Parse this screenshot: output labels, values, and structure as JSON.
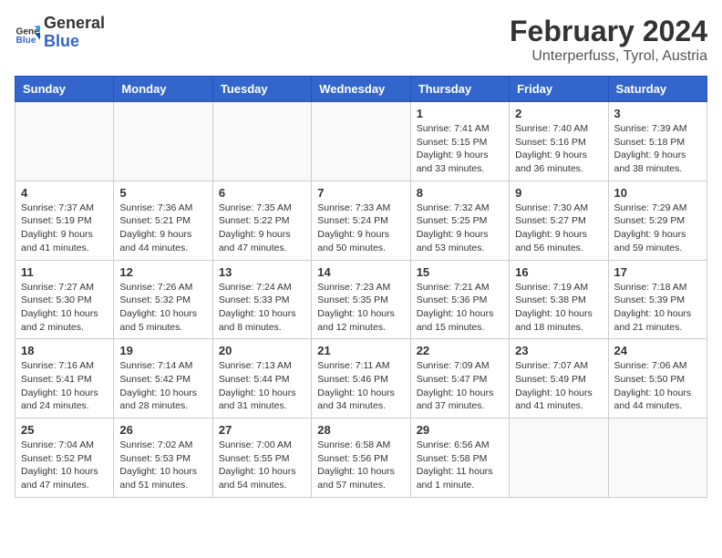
{
  "header": {
    "logo_line1": "General",
    "logo_line2": "Blue",
    "main_title": "February 2024",
    "sub_title": "Unterperfuss, Tyrol, Austria"
  },
  "days_of_week": [
    "Sunday",
    "Monday",
    "Tuesday",
    "Wednesday",
    "Thursday",
    "Friday",
    "Saturday"
  ],
  "weeks": [
    [
      {
        "day": "",
        "info": ""
      },
      {
        "day": "",
        "info": ""
      },
      {
        "day": "",
        "info": ""
      },
      {
        "day": "",
        "info": ""
      },
      {
        "day": "1",
        "info": "Sunrise: 7:41 AM\nSunset: 5:15 PM\nDaylight: 9 hours\nand 33 minutes."
      },
      {
        "day": "2",
        "info": "Sunrise: 7:40 AM\nSunset: 5:16 PM\nDaylight: 9 hours\nand 36 minutes."
      },
      {
        "day": "3",
        "info": "Sunrise: 7:39 AM\nSunset: 5:18 PM\nDaylight: 9 hours\nand 38 minutes."
      }
    ],
    [
      {
        "day": "4",
        "info": "Sunrise: 7:37 AM\nSunset: 5:19 PM\nDaylight: 9 hours\nand 41 minutes."
      },
      {
        "day": "5",
        "info": "Sunrise: 7:36 AM\nSunset: 5:21 PM\nDaylight: 9 hours\nand 44 minutes."
      },
      {
        "day": "6",
        "info": "Sunrise: 7:35 AM\nSunset: 5:22 PM\nDaylight: 9 hours\nand 47 minutes."
      },
      {
        "day": "7",
        "info": "Sunrise: 7:33 AM\nSunset: 5:24 PM\nDaylight: 9 hours\nand 50 minutes."
      },
      {
        "day": "8",
        "info": "Sunrise: 7:32 AM\nSunset: 5:25 PM\nDaylight: 9 hours\nand 53 minutes."
      },
      {
        "day": "9",
        "info": "Sunrise: 7:30 AM\nSunset: 5:27 PM\nDaylight: 9 hours\nand 56 minutes."
      },
      {
        "day": "10",
        "info": "Sunrise: 7:29 AM\nSunset: 5:29 PM\nDaylight: 9 hours\nand 59 minutes."
      }
    ],
    [
      {
        "day": "11",
        "info": "Sunrise: 7:27 AM\nSunset: 5:30 PM\nDaylight: 10 hours\nand 2 minutes."
      },
      {
        "day": "12",
        "info": "Sunrise: 7:26 AM\nSunset: 5:32 PM\nDaylight: 10 hours\nand 5 minutes."
      },
      {
        "day": "13",
        "info": "Sunrise: 7:24 AM\nSunset: 5:33 PM\nDaylight: 10 hours\nand 8 minutes."
      },
      {
        "day": "14",
        "info": "Sunrise: 7:23 AM\nSunset: 5:35 PM\nDaylight: 10 hours\nand 12 minutes."
      },
      {
        "day": "15",
        "info": "Sunrise: 7:21 AM\nSunset: 5:36 PM\nDaylight: 10 hours\nand 15 minutes."
      },
      {
        "day": "16",
        "info": "Sunrise: 7:19 AM\nSunset: 5:38 PM\nDaylight: 10 hours\nand 18 minutes."
      },
      {
        "day": "17",
        "info": "Sunrise: 7:18 AM\nSunset: 5:39 PM\nDaylight: 10 hours\nand 21 minutes."
      }
    ],
    [
      {
        "day": "18",
        "info": "Sunrise: 7:16 AM\nSunset: 5:41 PM\nDaylight: 10 hours\nand 24 minutes."
      },
      {
        "day": "19",
        "info": "Sunrise: 7:14 AM\nSunset: 5:42 PM\nDaylight: 10 hours\nand 28 minutes."
      },
      {
        "day": "20",
        "info": "Sunrise: 7:13 AM\nSunset: 5:44 PM\nDaylight: 10 hours\nand 31 minutes."
      },
      {
        "day": "21",
        "info": "Sunrise: 7:11 AM\nSunset: 5:46 PM\nDaylight: 10 hours\nand 34 minutes."
      },
      {
        "day": "22",
        "info": "Sunrise: 7:09 AM\nSunset: 5:47 PM\nDaylight: 10 hours\nand 37 minutes."
      },
      {
        "day": "23",
        "info": "Sunrise: 7:07 AM\nSunset: 5:49 PM\nDaylight: 10 hours\nand 41 minutes."
      },
      {
        "day": "24",
        "info": "Sunrise: 7:06 AM\nSunset: 5:50 PM\nDaylight: 10 hours\nand 44 minutes."
      }
    ],
    [
      {
        "day": "25",
        "info": "Sunrise: 7:04 AM\nSunset: 5:52 PM\nDaylight: 10 hours\nand 47 minutes."
      },
      {
        "day": "26",
        "info": "Sunrise: 7:02 AM\nSunset: 5:53 PM\nDaylight: 10 hours\nand 51 minutes."
      },
      {
        "day": "27",
        "info": "Sunrise: 7:00 AM\nSunset: 5:55 PM\nDaylight: 10 hours\nand 54 minutes."
      },
      {
        "day": "28",
        "info": "Sunrise: 6:58 AM\nSunset: 5:56 PM\nDaylight: 10 hours\nand 57 minutes."
      },
      {
        "day": "29",
        "info": "Sunrise: 6:56 AM\nSunset: 5:58 PM\nDaylight: 11 hours\nand 1 minute."
      },
      {
        "day": "",
        "info": ""
      },
      {
        "day": "",
        "info": ""
      }
    ]
  ]
}
